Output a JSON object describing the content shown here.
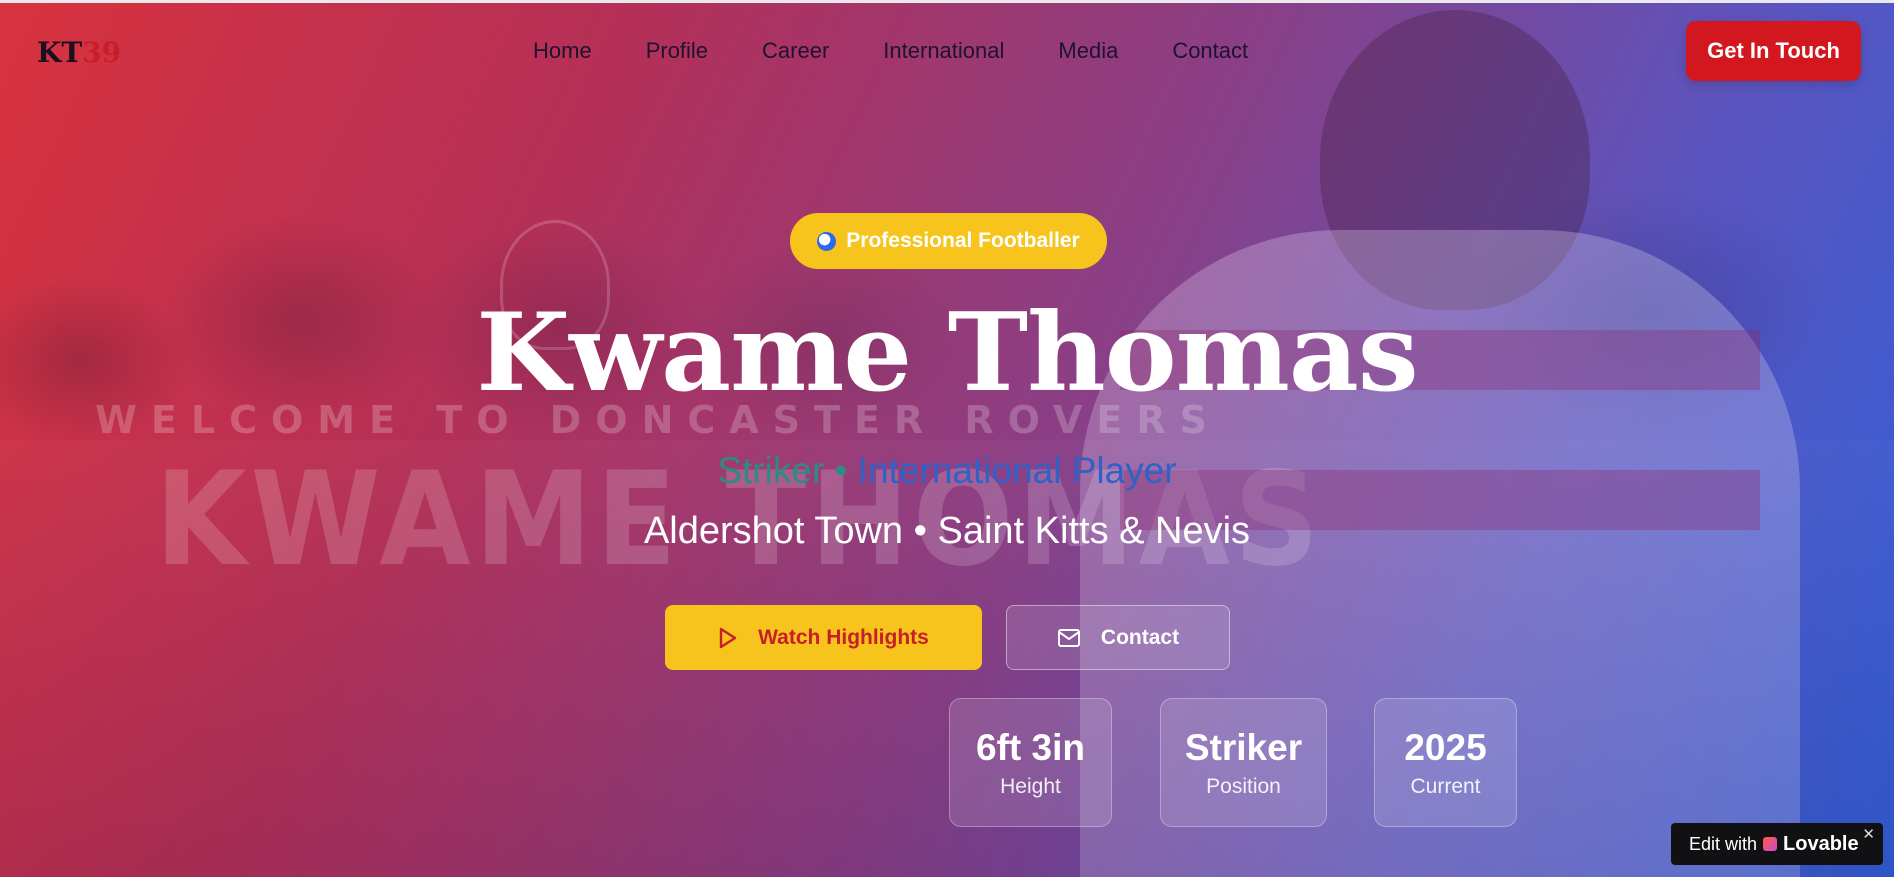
{
  "logo": {
    "letters": "KT",
    "number": "39"
  },
  "nav": {
    "items": [
      "Home",
      "Profile",
      "Career",
      "International",
      "Media",
      "Contact"
    ],
    "cta_label": "Get In Touch"
  },
  "hero": {
    "badge": "Professional Footballer",
    "title": "Kwame Thomas",
    "subtitle_part1": "Striker • ",
    "subtitle_part2": "International Player",
    "club_line": "Aldershot Town • Saint Kitts & Nevis",
    "primary_button": "Watch Highlights",
    "secondary_button": "Contact"
  },
  "background_text": {
    "welcome": "WELCOME TO DONCASTER ROVERS",
    "name": "KWAME THOMAS"
  },
  "stats": [
    {
      "value": "6ft 3in",
      "label": "Height"
    },
    {
      "value": "Striker",
      "label": "Position"
    },
    {
      "value": "2025",
      "label": "Current"
    }
  ],
  "lovable_badge": {
    "prefix": "Edit with",
    "brand": "Lovable",
    "close": "✕"
  },
  "colors": {
    "accent_red": "#d3171f",
    "accent_yellow": "#f6c41c",
    "gradient_start": "#d8323e",
    "gradient_end": "#2f5fd8"
  },
  "icons": {
    "badge_icon": "soccer-ball-icon",
    "primary_icon": "play-icon",
    "secondary_icon": "mail-icon"
  }
}
